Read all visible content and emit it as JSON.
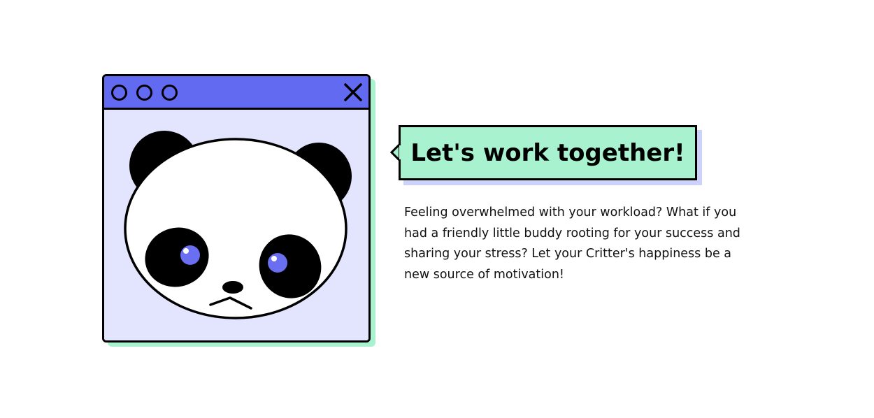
{
  "window": {
    "titlebar_color": "#636af2",
    "body_color": "#e2e5fd",
    "shadow_color": "#a8f2d0",
    "control_dots": [
      "circle-icon",
      "circle-icon",
      "circle-icon"
    ],
    "close_icon": "close-icon",
    "illustration": "sad-panda-face",
    "eye_color": "#6a6ef0"
  },
  "bubble": {
    "title": "Let's work together!",
    "background_color": "#a8f2d0",
    "shadow_color": "#cdd2fb"
  },
  "description": "Feeling overwhelmed with your workload? What if you had a friendly little buddy rooting for your success and sharing your stress? Let your Critter's happiness be a new source of motivation!"
}
